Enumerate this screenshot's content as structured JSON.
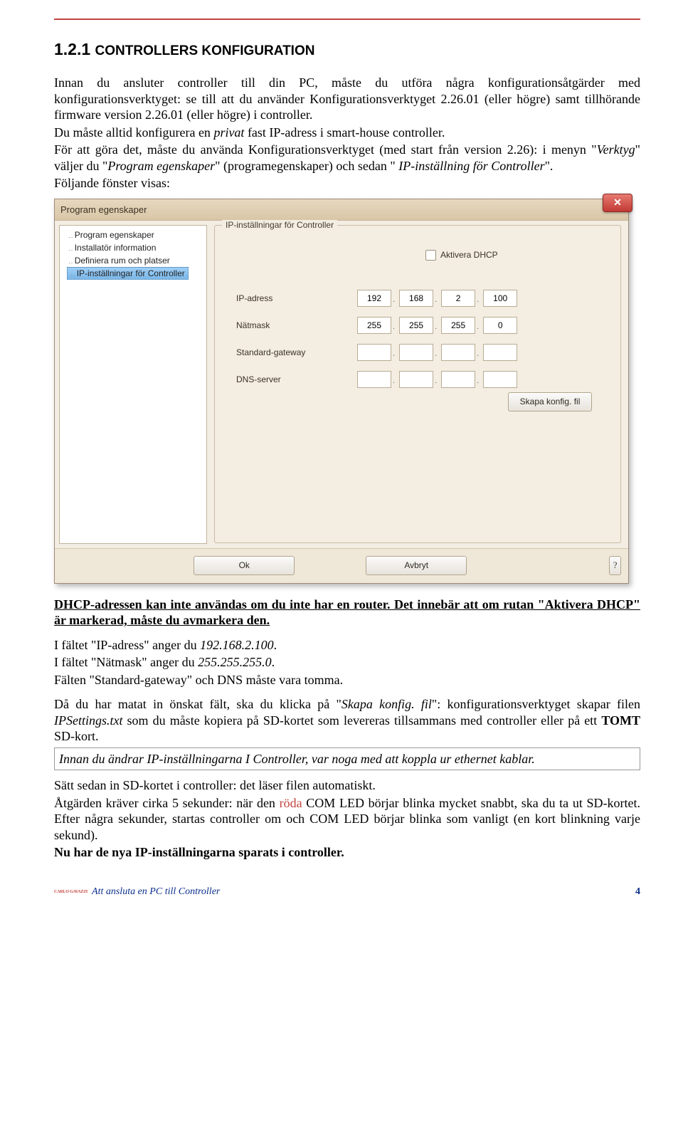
{
  "heading": {
    "number": "1.2.1 ",
    "text": "CONTROLLERS KONFIGURATION"
  },
  "para1a": "Innan du ansluter controller till din PC, måste du utföra några konfigurationsåtgärder med konfigurationsverktyget: se till att du använder Konfigurationsverktyget 2.26.01 (eller högre) samt tillhörande firmware version 2.26.01 (eller högre) i controller.",
  "para1b_pre": "Du måste alltid konfigurera en ",
  "para1b_it": "privat",
  "para1b_post": " fast IP-adress i smart-house controller.",
  "para1c_pre": "För att göra det, måste du använda Konfigurationsverktyget (med start från version 2.26): i menyn \"",
  "para1c_it1": "Verktyg",
  "para1c_mid1": "\" väljer du \"",
  "para1c_it2": "Program egenskaper",
  "para1c_mid2": "\" (programegenskaper) och sedan \" ",
  "para1c_it3": "IP-inställning för Controller",
  "para1c_post": "\".",
  "para1d": "Följande fönster visas:",
  "dialog": {
    "title": "Program egenskaper",
    "close": "✕",
    "tree": {
      "item1": "Program egenskaper",
      "item2": "Installatör information",
      "item3": "Definiera rum och platser",
      "item4": "IP-inställningar för Controller"
    },
    "group_legend": "IP-inställningar för Controller",
    "dhcp_label": "Aktivera DHCP",
    "rows": {
      "ip_label": "IP-adress",
      "ip": [
        "192",
        "168",
        "2",
        "100"
      ],
      "mask_label": "Nätmask",
      "mask": [
        "255",
        "255",
        "255",
        "0"
      ],
      "gw_label": "Standard-gateway",
      "gw": [
        "",
        "",
        "",
        ""
      ],
      "dns_label": "DNS-server",
      "dns": [
        "",
        "",
        "",
        ""
      ]
    },
    "create_btn": "Skapa konfig. fil",
    "ok_btn": "Ok",
    "cancel_btn": "Avbryt",
    "help_btn": "?"
  },
  "dhcp_warn_a": "DHCP-adressen kan inte användas om du inte har en router. Det innebär att om rutan \"Aktivera DHCP\" är markerad, måste du avmarkera den.",
  "field_ip_pre": "I fältet \"IP-adress\" anger du ",
  "field_ip_it": "192.168.2.100",
  "field_mask_pre": "I fältet \"Nätmask\" anger du ",
  "field_mask_it": "255.255.255.0",
  "fields_empty": "Fälten \"Standard-gateway\" och DNS måste vara tomma.",
  "para_skapa_pre": "Då du har matat in önskat fält, ska du klicka på \"",
  "para_skapa_it": "Skapa konfig. fil",
  "para_skapa_mid": "\": konfigurationsverktyget skapar filen ",
  "para_skapa_it2": "IPSettings.txt",
  "para_skapa_post1": " som du måste kopiera på SD-kortet som levereras tillsammans med controller eller på ett ",
  "para_skapa_bold": "TOMT",
  "para_skapa_post2": " SD-kort.",
  "callout": "Innan du ändrar IP-inställningarna I Controller, var noga med att koppla ur ethernet kablar.",
  "sd1": "Sätt sedan in SD-kortet i controller: det läser filen automatiskt.",
  "sd2_pre": "Åtgärden kräver cirka 5 sekunder: när den ",
  "sd2_red": "röda",
  "sd2_post": " COM LED börjar blinka mycket snabbt, ska du ta ut SD-kortet. Efter några sekunder, startas controller om och COM LED börjar blinka som vanligt (en kort blinkning varje sekund).",
  "sd3": "Nu har de nya IP-inställningarna sparats i controller.",
  "footer": {
    "logo": "CARLO GAVAZZI",
    "text": "Att ansluta en PC till Controller",
    "page": "4"
  }
}
